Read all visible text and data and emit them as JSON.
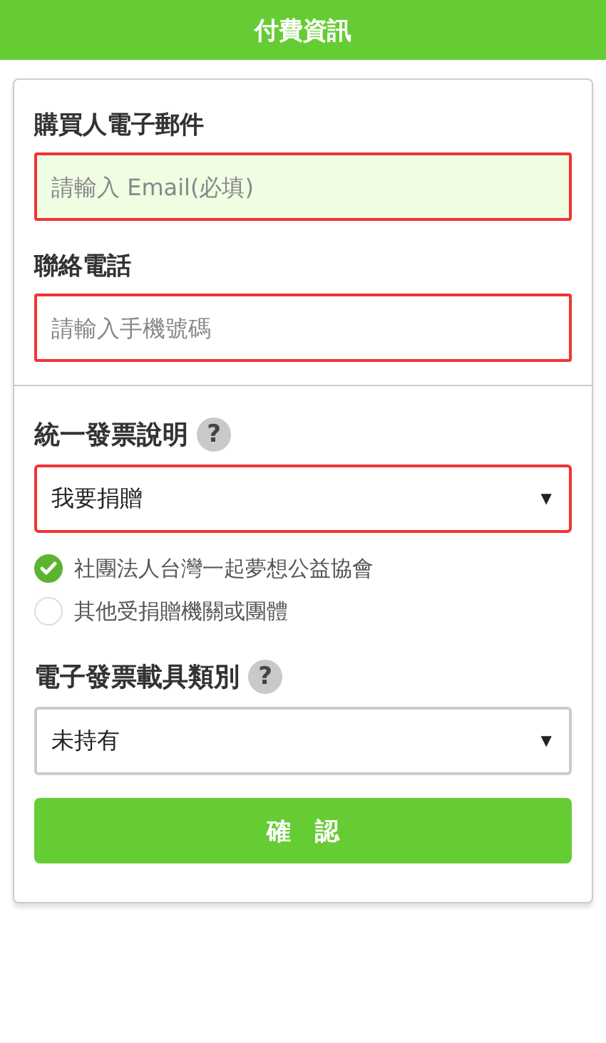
{
  "header": {
    "title": "付費資訊"
  },
  "contact_fields": [
    {
      "label": "購買人電子郵件",
      "placeholder": "請輸入 Email(必填)",
      "focused": true,
      "highlighted": true
    },
    {
      "label": "聯絡電話",
      "placeholder": "請輸入手機號碼",
      "focused": false,
      "highlighted": true
    }
  ],
  "invoice": {
    "heading": "統一發票說明",
    "help": "?",
    "select": {
      "value": "我要捐贈",
      "arrow": "▼",
      "highlighted": true
    },
    "options": [
      {
        "label": "社團法人台灣一起夢想公益協會",
        "selected": true
      },
      {
        "label": "其他受捐贈機關或團體",
        "selected": false
      }
    ]
  },
  "carrier": {
    "heading": "電子發票載具類別",
    "help": "?",
    "select": {
      "value": "未持有",
      "arrow": "▼",
      "highlighted": false
    }
  },
  "confirm_button": "確　認"
}
